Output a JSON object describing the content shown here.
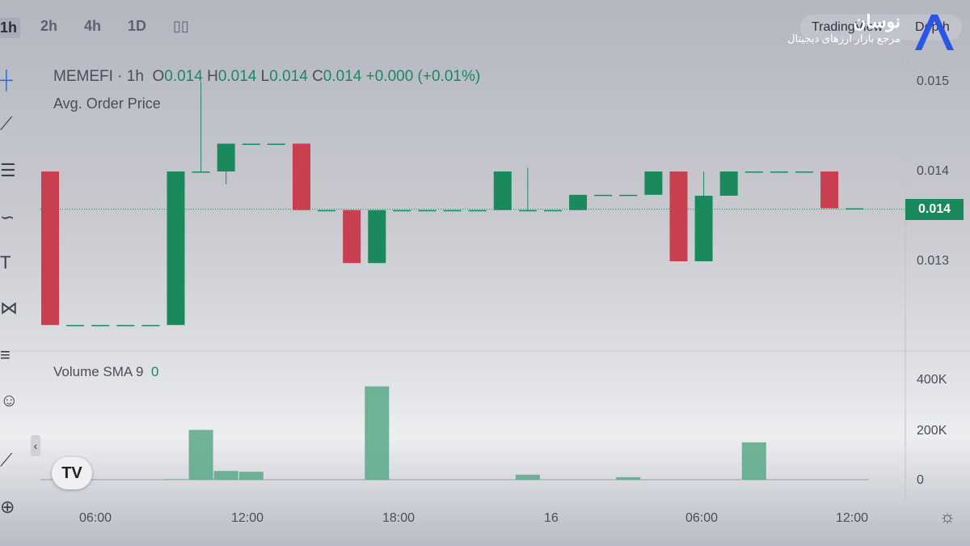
{
  "toolbar": {
    "timeframes": [
      "1h",
      "2h",
      "4h",
      "1D"
    ],
    "active": "1h",
    "chart_type_icon": "candles-icon"
  },
  "view_switch": {
    "tradingview": "TradingView",
    "depth": "Depth"
  },
  "brand": {
    "name": "نوسان",
    "tagline": "مرجع بازار ارزهای دیجیتال"
  },
  "legend": {
    "symbol": "MEMEFI",
    "interval": "1h",
    "o_label": "O",
    "o": "0.014",
    "h_label": "H",
    "h": "0.014",
    "l_label": "L",
    "l": "0.014",
    "c_label": "C",
    "c": "0.014",
    "change": "+0.000 (+0.01%)",
    "indicator": "Avg. Order Price",
    "volume_label": "Volume SMA 9",
    "volume_value": "0"
  },
  "price_axis": [
    "0.015",
    "0.014",
    "0.013"
  ],
  "current_price": "0.014",
  "volume_axis": [
    "400K",
    "200K",
    "0"
  ],
  "time_axis": [
    "06:00",
    "12:00",
    "18:00",
    "16",
    "06:00",
    "12:00"
  ],
  "colors": {
    "up": "#1a8a5c",
    "down": "#c8404f",
    "volume": "#5aa887"
  },
  "left_tools": [
    "crosshair-icon",
    "trendline-icon",
    "fib-icon",
    "brush-icon",
    "text-icon",
    "pattern-icon",
    "forecast-icon",
    "emoji-icon",
    "ruler-icon",
    "zoom-icon"
  ],
  "chart_data": {
    "type": "candlestick",
    "candles": [
      [
        0.014,
        0.014,
        0.01229,
        0.01229
      ],
      [
        0.01229,
        0.01229,
        0.01229,
        0.01229
      ],
      [
        0.01229,
        0.01229,
        0.01229,
        0.01229
      ],
      [
        0.01229,
        0.01229,
        0.01229,
        0.01229
      ],
      [
        0.01229,
        0.01229,
        0.01229,
        0.01229
      ],
      [
        0.01229,
        0.014,
        0.01229,
        0.014
      ],
      [
        0.014,
        0.015,
        0.014,
        0.014
      ],
      [
        0.014,
        0.01431,
        0.01386,
        0.01431
      ],
      [
        0.01431,
        0.01431,
        0.01431,
        0.01431
      ],
      [
        0.01431,
        0.01431,
        0.01431,
        0.01431
      ],
      [
        0.01431,
        0.01431,
        0.01357,
        0.01357
      ],
      [
        0.01357,
        0.01357,
        0.01357,
        0.01357
      ],
      [
        0.01357,
        0.01357,
        0.01298,
        0.01298
      ],
      [
        0.01298,
        0.01357,
        0.01298,
        0.01357
      ],
      [
        0.01357,
        0.01357,
        0.01357,
        0.01357
      ],
      [
        0.01357,
        0.01357,
        0.01357,
        0.01357
      ],
      [
        0.01357,
        0.01357,
        0.01357,
        0.01357
      ],
      [
        0.01357,
        0.01357,
        0.01357,
        0.01357
      ],
      [
        0.01357,
        0.014,
        0.01357,
        0.014
      ],
      [
        0.01357,
        0.01404,
        0.01357,
        0.01357
      ],
      [
        0.01357,
        0.01357,
        0.01357,
        0.01357
      ],
      [
        0.01357,
        0.01374,
        0.01357,
        0.01374
      ],
      [
        0.01374,
        0.01374,
        0.01374,
        0.01374
      ],
      [
        0.01374,
        0.01374,
        0.01374,
        0.01374
      ],
      [
        0.01374,
        0.014,
        0.01374,
        0.014
      ],
      [
        0.014,
        0.014,
        0.013,
        0.013
      ],
      [
        0.013,
        0.014,
        0.013,
        0.01373
      ],
      [
        0.01373,
        0.014,
        0.01373,
        0.014
      ],
      [
        0.014,
        0.014,
        0.014,
        0.014
      ],
      [
        0.014,
        0.014,
        0.014,
        0.014
      ],
      [
        0.014,
        0.014,
        0.014,
        0.014
      ],
      [
        0.014,
        0.014,
        0.01359,
        0.01359
      ],
      [
        0.01359,
        0.01359,
        0.01359,
        0.01359
      ]
    ],
    "volumes": [
      0,
      0,
      0,
      0,
      0,
      2000,
      200000,
      35000,
      32000,
      0,
      0,
      0,
      0,
      375000,
      0,
      0,
      0,
      0,
      0,
      20000,
      0,
      0,
      0,
      10000,
      0,
      0,
      0,
      0,
      150000,
      0,
      0,
      0,
      0
    ],
    "price_range": [
      0.0121,
      0.0152
    ],
    "volume_range": [
      0,
      450000
    ]
  }
}
